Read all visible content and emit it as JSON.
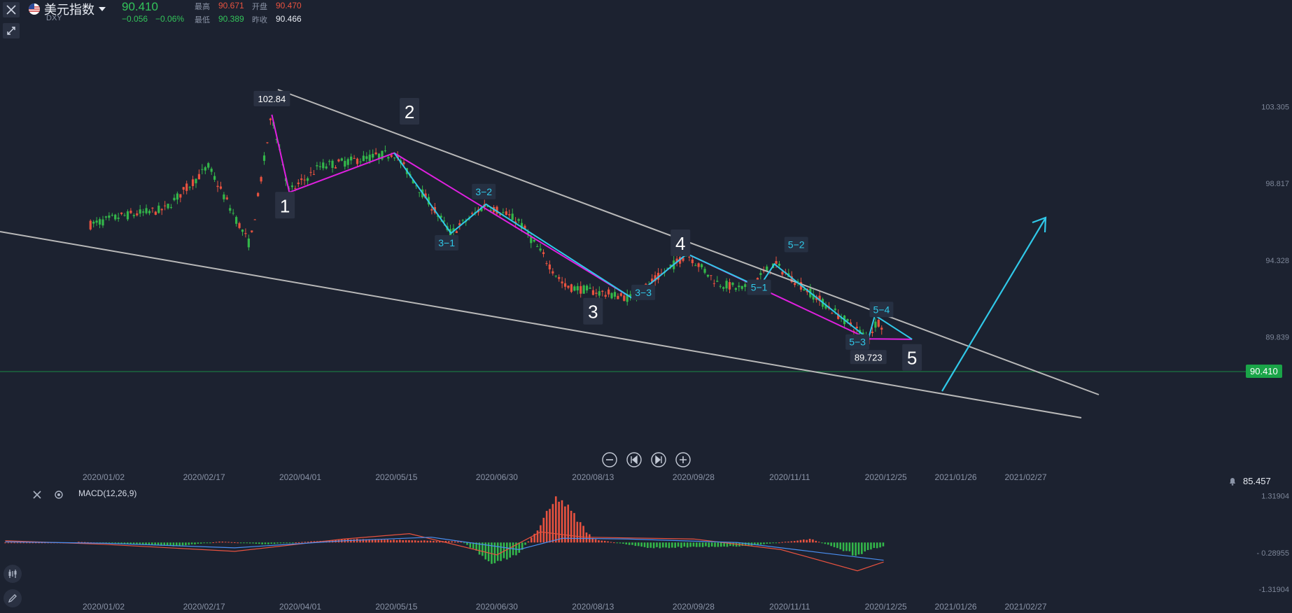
{
  "header": {
    "close_icon": "close-icon",
    "flag_icon": "us-flag-icon",
    "symbol_name": "美元指数",
    "dropdown_icon": "caret-down-icon",
    "symbol_code": "DXY",
    "last_price": "90.410",
    "change": "−0.056",
    "change_pct": "−0.06%",
    "high_label": "最高",
    "high_value": "90.671",
    "open_label": "开盘",
    "open_value": "90.470",
    "low_label": "最低",
    "low_value": "90.389",
    "prev_label": "昨收",
    "prev_value": "90.466",
    "collapse_icon": "collapse-arrows-icon"
  },
  "colors": {
    "bg": "#1c2230",
    "up": "#e8523f",
    "down": "#33b74a",
    "magenta": "#e020e0",
    "cyan": "#30c8e8",
    "trend": "#b8b8b8",
    "price_line": "#1aa548"
  },
  "chart_data": [
    {
      "type": "candlestick",
      "x": [
        "2020/01/02",
        "2020/02/17",
        "2020/04/01",
        "2020/05/15",
        "2020/06/30",
        "2020/08/13",
        "2020/09/28",
        "2020/11/11",
        "2020/12/25",
        "2021/01/26",
        "2021/02/27"
      ],
      "x_tick_labels": [
        "2020/01/02",
        "2020/02/17",
        "2020/04/01",
        "2020/05/15",
        "2020/06/30",
        "2020/08/13",
        "2020/09/28",
        "2020/11/11",
        "2020/12/25",
        "2021/01/26",
        "2021/02/27"
      ],
      "y_tick_labels": [
        "103.305",
        "98.817",
        "94.328",
        "89.839"
      ],
      "y_ticks": [
        103.305,
        98.817,
        94.328,
        89.839
      ],
      "ylim": [
        86.95,
        104.8
      ],
      "current_price": 90.41,
      "current_price_label": "90.410",
      "wave_points": [
        {
          "date": "2020/03/19",
          "value": 102.84
        },
        {
          "date": "2020/03/27",
          "value": 98.3
        },
        {
          "date": "2020/05/14",
          "value": 100.6
        },
        {
          "date": "2020/06/09",
          "value": 95.9
        },
        {
          "date": "2020/06/25",
          "value": 97.6
        },
        {
          "date": "2020/08/31",
          "value": 92.1
        },
        {
          "date": "2020/09/25",
          "value": 94.7
        },
        {
          "date": "2020/11/04",
          "value": 94.1
        },
        {
          "date": "2020/12/17",
          "value": 89.723
        },
        {
          "date": "2021/01/06",
          "value": 89.7
        }
      ],
      "wave_labels": [
        {
          "text": "1",
          "date": "2020/03/25",
          "value": 97.5,
          "big": true
        },
        {
          "text": "2",
          "date": "2020/05/21",
          "value": 103.0,
          "big": true
        },
        {
          "text": "3",
          "date": "2020/08/13",
          "value": 91.3,
          "big": true
        },
        {
          "text": "4",
          "date": "2020/09/22",
          "value": 95.3,
          "big": true
        },
        {
          "text": "5",
          "date": "2021/01/06",
          "value": 88.6,
          "big": true
        },
        {
          "text": "3−1",
          "date": "2020/06/07",
          "value": 95.3
        },
        {
          "text": "3−2",
          "date": "2020/06/24",
          "value": 98.3
        },
        {
          "text": "3−3",
          "date": "2020/09/05",
          "value": 92.4
        },
        {
          "text": "5−1",
          "date": "2020/10/28",
          "value": 92.7
        },
        {
          "text": "5−2",
          "date": "2020/11/14",
          "value": 95.2
        },
        {
          "text": "5−3",
          "date": "2020/12/12",
          "value": 89.5
        },
        {
          "text": "5−4",
          "date": "2020/12/23",
          "value": 91.4
        }
      ],
      "annotations": [
        "102.84",
        "89.723"
      ]
    },
    {
      "type": "macd",
      "name": "MACD(12,26,9)",
      "y_tick_labels": [
        "1.31904",
        "- 0.28955",
        "-1.31904"
      ],
      "y_ticks": [
        1.31904,
        -0.28955,
        -1.31904
      ],
      "ylim": [
        -1.38,
        1.45
      ],
      "left_value_label": "85.457"
    }
  ],
  "toolbar": {
    "zoom_out_icon": "zoom-out-icon",
    "back_icon": "step-back-icon",
    "forward_icon": "step-forward-icon",
    "zoom_in_icon": "zoom-in-icon"
  },
  "macd_panel": {
    "close_icon": "close-icon",
    "settings_icon": "settings-gear-icon"
  },
  "side_tools": {
    "indicator_icon": "indicator-candles-icon",
    "pencil_icon": "pencil-icon"
  }
}
